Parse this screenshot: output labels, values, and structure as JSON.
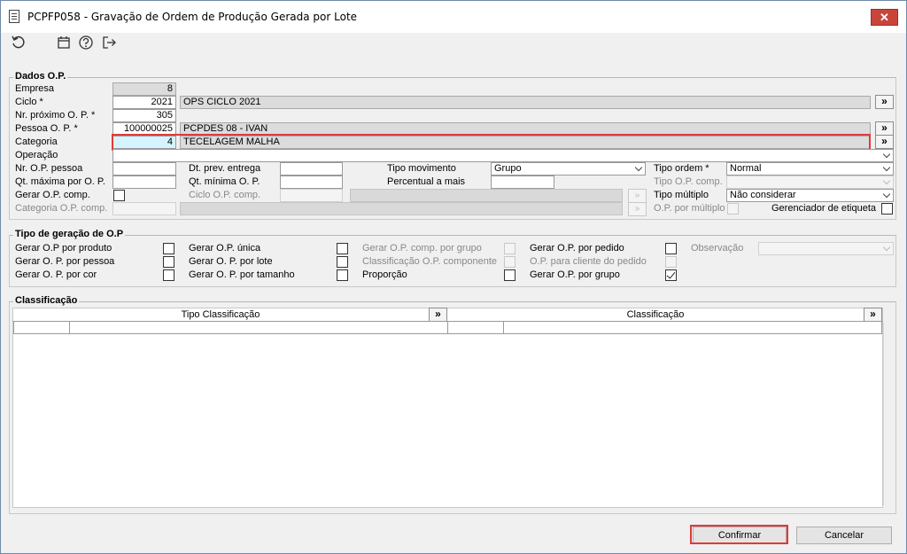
{
  "window": {
    "title": "PCPFP058 - Gravação de Ordem de Produção Gerada por Lote",
    "close_label": "✕"
  },
  "toolbar": {
    "icons": [
      "refresh-icon",
      "calendar-icon",
      "help-icon",
      "exit-icon"
    ]
  },
  "dados_op": {
    "title": "Dados O.P.",
    "empresa": {
      "label": "Empresa",
      "value": "8"
    },
    "ciclo": {
      "label": "Ciclo *",
      "value": "2021",
      "desc": "OPS CICLO 2021",
      "lookup": "»"
    },
    "nr_proximo": {
      "label": "Nr. próximo O. P. *",
      "value": "305"
    },
    "pessoa": {
      "label": "Pessoa O. P. *",
      "value": "100000025",
      "desc": "PCPDES 08 - IVAN",
      "lookup": "»"
    },
    "categoria": {
      "label": "Categoria",
      "value": "4",
      "desc": "TECELAGEM MALHA",
      "lookup": "»"
    },
    "operacao": {
      "label": "Operação",
      "value": ""
    },
    "nr_op_pessoa": {
      "label": "Nr. O.P. pessoa",
      "value": ""
    },
    "qt_maxima": {
      "label": "Qt. máxima por O. P.",
      "value": ""
    },
    "gerar_op_comp": {
      "label": "Gerar O.P. comp.",
      "checked": false
    },
    "categoria_op_comp": {
      "label": "Categoria O.P. comp.",
      "value": ""
    },
    "dt_prev_entrega": {
      "label": "Dt. prev. entrega",
      "value": ""
    },
    "qt_minima": {
      "label": "Qt. mínima O. P.",
      "value": ""
    },
    "ciclo_op_comp": {
      "label": "Ciclo O.P. comp.",
      "value": ""
    },
    "tipo_movimento": {
      "label": "Tipo movimento",
      "value": "Grupo"
    },
    "percentual_a_mais": {
      "label": "Percentual a mais",
      "value": ""
    },
    "tipo_ordem": {
      "label": "Tipo ordem *",
      "value": "Normal"
    },
    "tipo_op_comp": {
      "label": "Tipo O.P. comp.",
      "value": ""
    },
    "tipo_multiplo": {
      "label": "Tipo múltiplo",
      "value": "Não considerar"
    },
    "op_por_multiplo": {
      "label": "O.P. por múltiplo",
      "checked": false
    },
    "gerenciador_etiqueta": {
      "label": "Gerenciador de etiqueta",
      "checked": false
    }
  },
  "tipo_geracao": {
    "title": "Tipo de geração de O.P",
    "col1": [
      {
        "label": "Gerar O.P por produto",
        "checked": false
      },
      {
        "label": "Gerar O. P. por pessoa",
        "checked": false
      },
      {
        "label": "Gerar O. P. por cor",
        "checked": false
      }
    ],
    "col2": [
      {
        "label": "Gerar O.P. única",
        "checked": false
      },
      {
        "label": "Gerar O. P. por lote",
        "checked": false
      },
      {
        "label": "Gerar O. P. por tamanho",
        "checked": false
      }
    ],
    "col3": [
      {
        "label": "Gerar O.P. comp. por grupo",
        "checked": false
      },
      {
        "label": "Classificação O.P. componente",
        "checked": false
      },
      {
        "label": "Proporção",
        "checked": false
      }
    ],
    "col4": [
      {
        "label": "Gerar O.P. por pedido",
        "checked": false
      },
      {
        "label": "O.P. para cliente do pedido",
        "checked": false
      },
      {
        "label": "Gerar O.P. por grupo",
        "checked": true
      }
    ],
    "observacao": {
      "label": "Observação",
      "value": ""
    }
  },
  "classificacao": {
    "title": "Classificação",
    "col_tipo": "Tipo Classificação",
    "col_class": "Classificação",
    "lookup": "»"
  },
  "footer": {
    "confirmar": "Confirmar",
    "cancelar": "Cancelar"
  }
}
